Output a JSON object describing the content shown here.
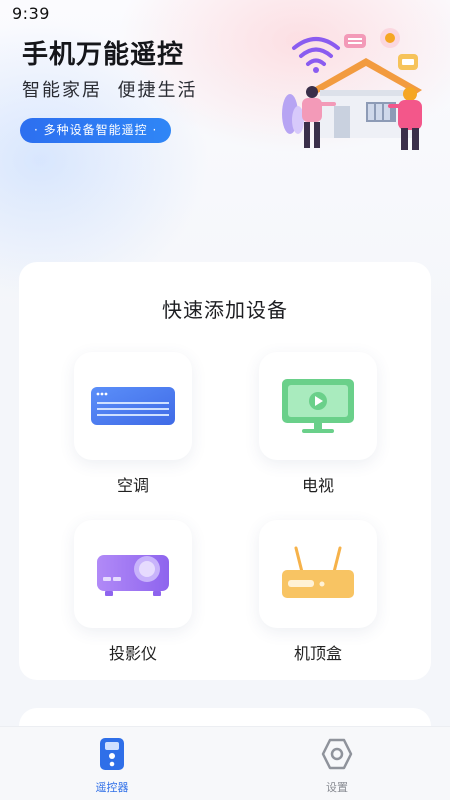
{
  "status_bar": {
    "time": "9:39"
  },
  "header": {
    "title": "手机万能遥控",
    "subtitle": "智能家居  便捷生活",
    "feature_pill": "· 多种设备智能遥控 ·"
  },
  "quick_add": {
    "title": "快速添加设备",
    "devices": [
      {
        "label": "空调",
        "icon": "air-conditioner-icon"
      },
      {
        "label": "电视",
        "icon": "tv-icon"
      },
      {
        "label": "投影仪",
        "icon": "projector-icon"
      },
      {
        "label": "机顶盒",
        "icon": "set-top-box-icon"
      }
    ]
  },
  "tabbar": {
    "tabs": [
      {
        "label": "遥控器",
        "icon": "remote-icon",
        "active": true
      },
      {
        "label": "设置",
        "icon": "hexagon-settings-icon",
        "active": false
      }
    ]
  },
  "colors": {
    "accent": "#2f6fe8",
    "background": "#f4f6fa",
    "card": "#ffffff"
  }
}
